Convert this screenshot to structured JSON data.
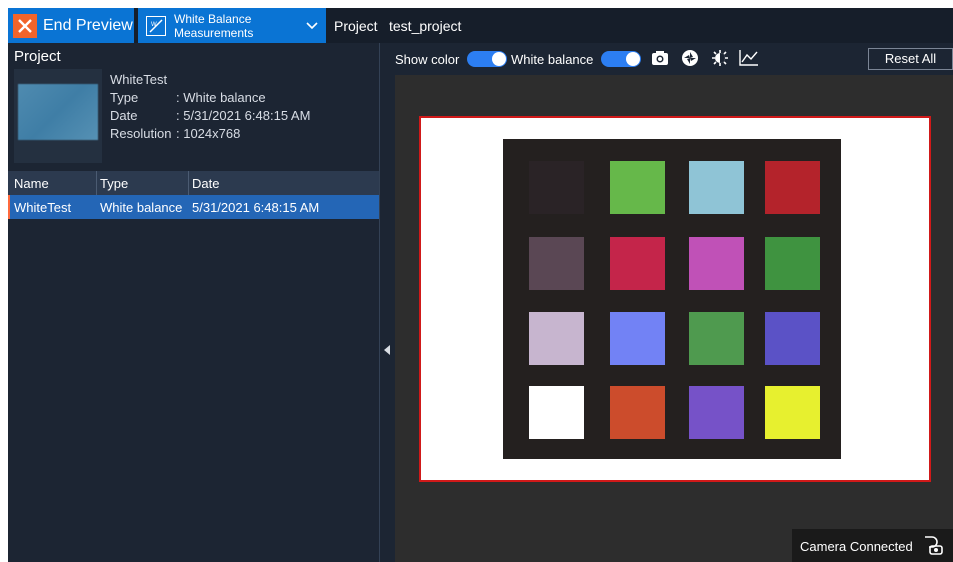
{
  "topbar": {
    "end_preview_label": "End Preview",
    "mode_label": "White Balance Measurements",
    "project_label": "Project",
    "project_name": "test_project"
  },
  "left_panel": {
    "title": "Project",
    "item_name": "WhiteTest",
    "meta": [
      {
        "key": "Type",
        "value": ": White balance"
      },
      {
        "key": "Date",
        "value": ": 5/31/2021 6:48:15 AM"
      },
      {
        "key": "Resolution",
        "value": ": 1024x768"
      }
    ],
    "table": {
      "headers": [
        "Name",
        "Type",
        "Date"
      ],
      "rows": [
        {
          "name": "WhiteTest",
          "type": "White balance",
          "date": "5/31/2021 6:48:15 AM"
        }
      ]
    }
  },
  "toolbar": {
    "show_color_label": "Show color",
    "show_color_on": true,
    "white_balance_label": "White balance",
    "white_balance_on": true,
    "icons": [
      "camera-icon",
      "aperture-icon",
      "brightness-icon",
      "chart-line-icon"
    ],
    "reset_label": "Reset All"
  },
  "preview": {
    "swatches": [
      [
        "#2a2326",
        "#66b84a",
        "#8fc4d6",
        "#b4232b"
      ],
      [
        "#5a4754",
        "#c4254a",
        "#c051b7",
        "#3f9340"
      ],
      [
        "#c7b5cf",
        "#7282f5",
        "#4f9a4f",
        "#5b52c6"
      ],
      [
        "#ffffff",
        "#cc4c2c",
        "#7652c8",
        "#e7f02f"
      ]
    ]
  },
  "status": {
    "text": "Camera Connected",
    "icon": "camera-link-icon"
  },
  "colors": {
    "accent": "#0a74d4",
    "panel": "#1c2533",
    "selected_row": "#2466b6",
    "frame_border": "#d01919"
  }
}
